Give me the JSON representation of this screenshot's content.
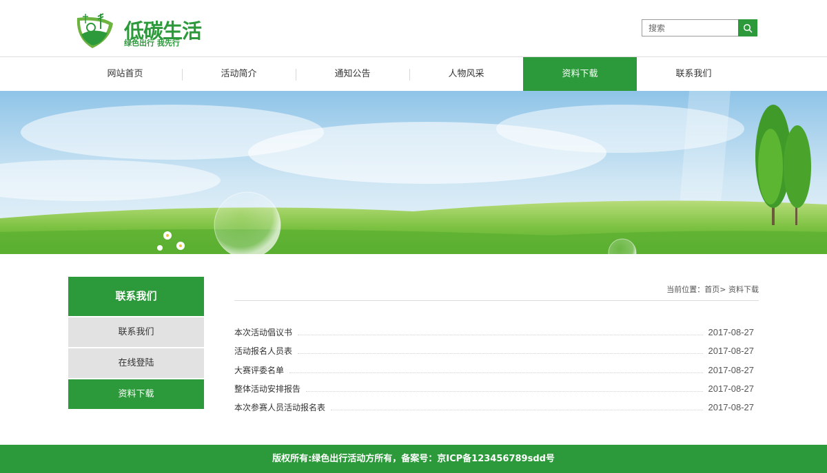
{
  "logo": {
    "title": "低碳生活",
    "subtitle": "绿色出行 我先行"
  },
  "search": {
    "placeholder": "搜索",
    "button_icon": "search-icon"
  },
  "nav": {
    "items": [
      {
        "label": "网站首页"
      },
      {
        "label": "活动简介"
      },
      {
        "label": "通知公告"
      },
      {
        "label": "人物风采"
      },
      {
        "label": "资料下载",
        "active": true
      },
      {
        "label": "联系我们"
      }
    ]
  },
  "sidebar": {
    "heading": "联系我们",
    "items": [
      {
        "label": "联系我们"
      },
      {
        "label": "在线登陆"
      },
      {
        "label": "资料下载",
        "active": true
      }
    ]
  },
  "breadcrumb": {
    "prefix": "当前位置：",
    "home": "首页",
    "separator": ">",
    "current": "资料下载"
  },
  "list": [
    {
      "title": "本次活动倡议书",
      "date": "2017-08-27"
    },
    {
      "title": "活动报名人员表",
      "date": "2017-08-27"
    },
    {
      "title": "大赛评委名单",
      "date": "2017-08-27"
    },
    {
      "title": "整体活动安排报告",
      "date": "2017-08-27"
    },
    {
      "title": "本次参赛人员活动报名表",
      "date": "2017-08-27"
    }
  ],
  "footer": {
    "text": "版权所有:绿色出行活动方所有，备案号：京ICP备123456789sdd号"
  },
  "colors": {
    "accent": "#2c9a3a",
    "sidebar_inactive": "#e2e2e2"
  }
}
